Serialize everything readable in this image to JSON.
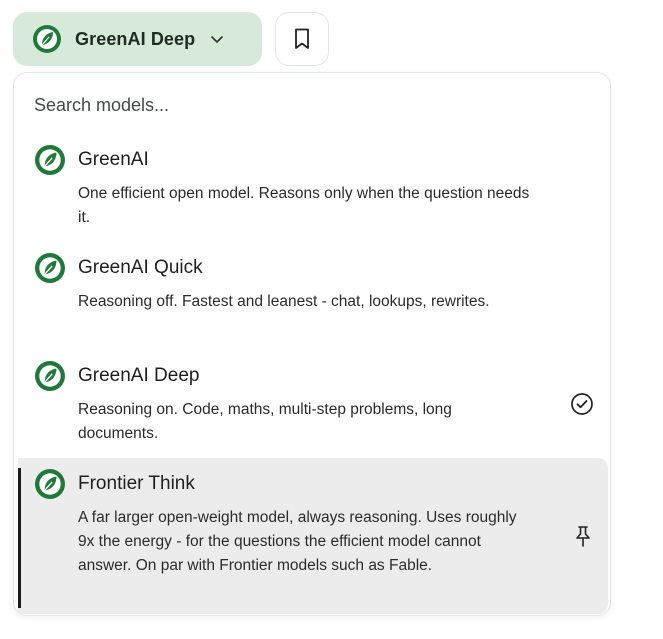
{
  "trigger": {
    "label": "GreenAI Deep"
  },
  "search": {
    "placeholder": "Search models..."
  },
  "models": [
    {
      "name": "GreenAI",
      "description": "One efficient open model. Reasons only when the question needs it.",
      "selected": false,
      "pinned": false
    },
    {
      "name": "GreenAI Quick",
      "description": "Reasoning off. Fastest and leanest - chat, lookups, rewrites.",
      "selected": false,
      "pinned": false
    },
    {
      "name": "GreenAI Deep",
      "description": "Reasoning on. Code, maths, multi-step problems, long documents.",
      "selected": true,
      "pinned": false
    },
    {
      "name": "Frontier Think",
      "description": "A far larger open-weight model, always reasoning. Uses roughly 9x the energy - for the questions the efficient model cannot answer. On par with Frontier models such as Fable.",
      "selected": false,
      "pinned": true
    }
  ],
  "colors": {
    "brand_green": "#1f7a3a",
    "trigger_bg": "#d7ead9",
    "highlight_bg": "#ececec"
  },
  "icons": {
    "logo": "leaf-logo-icon",
    "chevron": "chevron-down-icon",
    "bookmark": "bookmark-icon",
    "selected": "check-circle-icon",
    "pin": "pin-icon"
  }
}
